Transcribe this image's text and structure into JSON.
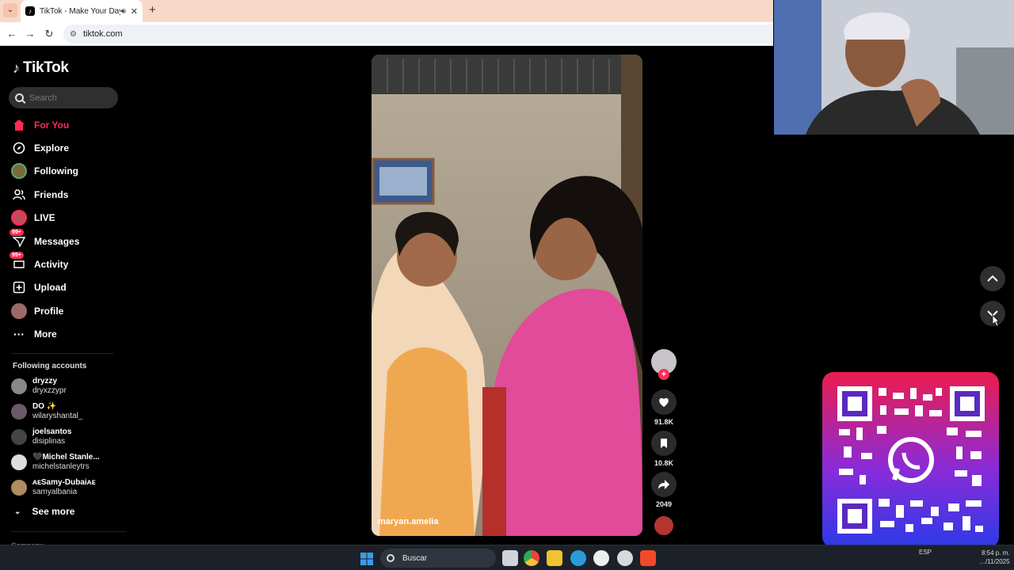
{
  "browser": {
    "tab_title": "TikTok - Make Your Day",
    "url": "tiktok.com",
    "new_tab": "+",
    "close": "✕"
  },
  "tiktok": {
    "logo_text": "TikTok",
    "search_placeholder": "Search",
    "nav": [
      {
        "label": "For You",
        "icon": "home-icon",
        "active": true
      },
      {
        "label": "Explore",
        "icon": "compass-icon"
      },
      {
        "label": "Following",
        "icon": "following-avatar"
      },
      {
        "label": "Friends",
        "icon": "friends-icon"
      },
      {
        "label": "LIVE",
        "icon": "live-avatar"
      },
      {
        "label": "Messages",
        "icon": "messages-icon",
        "badge": "99+"
      },
      {
        "label": "Activity",
        "icon": "activity-icon",
        "badge": "99+"
      },
      {
        "label": "Upload",
        "icon": "upload-icon"
      },
      {
        "label": "Profile",
        "icon": "profile-avatar"
      },
      {
        "label": "More",
        "icon": "more-icon"
      }
    ],
    "following_title": "Following accounts",
    "following": [
      {
        "name": "dryzzy",
        "handle": "dryxzzypr"
      },
      {
        "name": "DO ✨",
        "handle": "wilaryshantal_"
      },
      {
        "name": "joelsantos",
        "handle": "disiplinas"
      },
      {
        "name": "🖤Michel Stanle...",
        "handle": "michelstanleytrs"
      },
      {
        "name": "ᴀᴇSamy-Dubaiᴀᴇ",
        "handle": "samyalbania"
      }
    ],
    "see_more": "See more",
    "company": "Company"
  },
  "video": {
    "author": "maryan.amelia",
    "likes": "91.8K",
    "saves": "10.8K",
    "shares": "2049"
  },
  "taskbar": {
    "search_label": "Buscar",
    "time": "8:54 p. m.",
    "date": "…/11/2025",
    "lang": "ESP"
  },
  "colors": {
    "accent": "#fe2c55",
    "sidebar_bg": "#000000",
    "qr_gradient_top": "#ec1c4e",
    "qr_gradient_bottom": "#2c3ae8"
  }
}
